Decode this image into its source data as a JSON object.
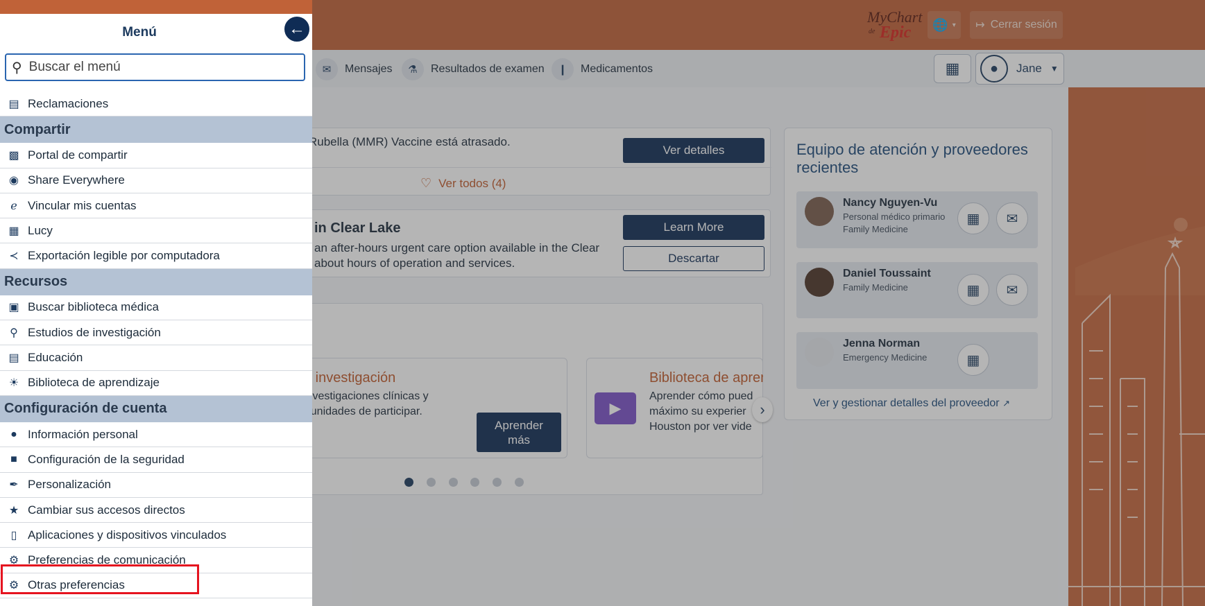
{
  "header": {
    "logo": {
      "my": "MyChart",
      "de": "de",
      "epic": "Epic"
    },
    "lang_icon": "globe-icon",
    "logout_label": "Cerrar sesión"
  },
  "nav": {
    "items": [
      {
        "label": "Mensajes",
        "icon": "envelope-icon"
      },
      {
        "label": "Resultados de examen",
        "icon": "flask-icon"
      },
      {
        "label": "Medicamentos",
        "icon": "pills-icon"
      }
    ],
    "user_name": "Jane"
  },
  "alerts": {
    "vaccine_text": "Rubella (MMR) Vaccine está atrasado.",
    "details_button": "Ver detalles",
    "view_all": "Ver todos (4)"
  },
  "promo": {
    "title": "in Clear Lake",
    "line1": "an after-hours urgent care option available in the Clear",
    "line2": "about hours of operation and services.",
    "learn_more": "Learn More",
    "dismiss": "Descartar"
  },
  "carousel": {
    "card1": {
      "title": "e investigación",
      "line1": "investigaciones clínicas y",
      "line2": "rtunidades de participar.",
      "button": "Aprender más"
    },
    "card2": {
      "title": "Biblioteca de aprer",
      "line1": "Aprender cómo pued",
      "line2": "máximo su experier",
      "line3": "Houston por ver vide"
    }
  },
  "care_team": {
    "title": "Equipo de atención y proveedores recientes",
    "providers": [
      {
        "name": "Nancy Nguyen-Vu",
        "role": "Personal médico primario",
        "dept": "Family Medicine"
      },
      {
        "name": "Daniel Toussaint",
        "dept": "Family Medicine"
      },
      {
        "name": "Jenna Norman",
        "dept": "Emergency Medicine"
      }
    ],
    "manage_link": "Ver y gestionar detalles del proveedor"
  },
  "menu": {
    "title": "Menú",
    "search_placeholder": "Buscar el menú",
    "items": [
      {
        "type": "item",
        "label": "Reclamaciones",
        "icon": "document-icon"
      },
      {
        "type": "section",
        "label": "Compartir"
      },
      {
        "type": "item",
        "label": "Portal de compartir",
        "icon": "share-portal-icon"
      },
      {
        "type": "item",
        "label": "Share Everywhere",
        "icon": "globe-share-icon"
      },
      {
        "type": "item",
        "label": "Vincular mis cuentas",
        "icon": "link-accounts-icon"
      },
      {
        "type": "item",
        "label": "Lucy",
        "icon": "lucy-icon"
      },
      {
        "type": "item",
        "label": "Exportación legible por computadora",
        "icon": "code-export-icon"
      },
      {
        "type": "section",
        "label": "Recursos"
      },
      {
        "type": "item",
        "label": "Buscar biblioteca médica",
        "icon": "medical-library-icon"
      },
      {
        "type": "item",
        "label": "Estudios de investigación",
        "icon": "research-icon"
      },
      {
        "type": "item",
        "label": "Educación",
        "icon": "book-icon"
      },
      {
        "type": "item",
        "label": "Biblioteca de aprendizaje",
        "icon": "lightbulb-icon"
      },
      {
        "type": "section",
        "label": "Configuración de cuenta"
      },
      {
        "type": "item",
        "label": "Información personal",
        "icon": "person-icon"
      },
      {
        "type": "item",
        "label": "Configuración de la seguridad",
        "icon": "lock-icon"
      },
      {
        "type": "item",
        "label": "Personalización",
        "icon": "paintbrush-icon"
      },
      {
        "type": "item",
        "label": "Cambiar sus accesos directos",
        "icon": "star-icon"
      },
      {
        "type": "item",
        "label": "Aplicaciones y dispositivos vinculados",
        "icon": "device-link-icon"
      },
      {
        "type": "item",
        "label": "Preferencias de comunicación",
        "icon": "phone-gear-icon"
      },
      {
        "type": "item",
        "label": "Otras preferencias",
        "icon": "gear-icon"
      }
    ]
  }
}
